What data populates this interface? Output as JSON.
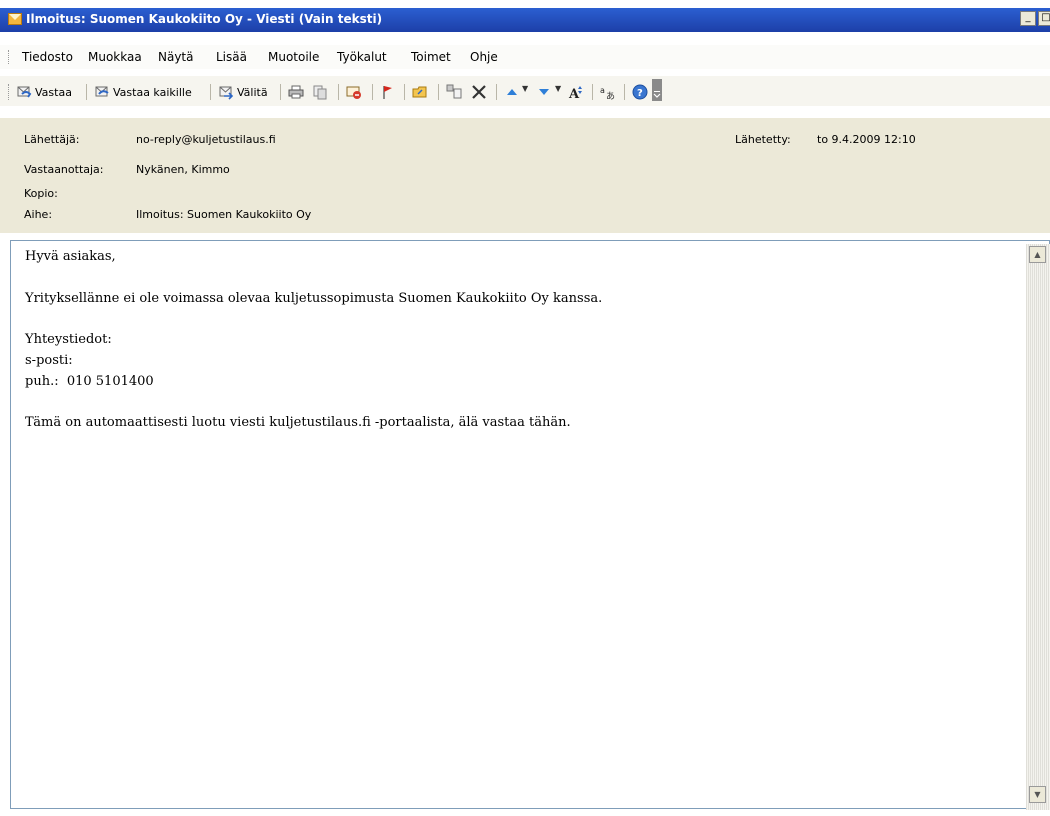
{
  "window": {
    "title": "Ilmoitus: Suomen Kaukokiito Oy - Viesti (Vain teksti)"
  },
  "menu": {
    "items": [
      {
        "label": "Tiedosto"
      },
      {
        "label": "Muokkaa"
      },
      {
        "label": "Näytä"
      },
      {
        "label": "Lisää"
      },
      {
        "label": "Muotoile"
      },
      {
        "label": "Työkalut"
      },
      {
        "label": "Toimet"
      },
      {
        "label": "Ohje"
      }
    ]
  },
  "toolbar": {
    "reply_label": "Vastaa",
    "reply_all_label": "Vastaa kaikille",
    "forward_label": "Välitä"
  },
  "header": {
    "from_label": "Lähettäjä:",
    "from_value": "no-reply@kuljetustilaus.fi",
    "sent_label": "Lähetetty:",
    "sent_value": "to 9.4.2009 12:10",
    "to_label": "Vastaanottaja:",
    "to_value": "Nykänen, Kimmo",
    "cc_label": "Kopio:",
    "cc_value": "",
    "subject_label": "Aihe:",
    "subject_value": "Ilmoitus: Suomen Kaukokiito Oy"
  },
  "body": {
    "lines": [
      "Hyvä asiakas,",
      "",
      "Yrityksellänne ei ole voimassa olevaa kuljetussopimusta Suomen Kaukokiito Oy kanssa.",
      "",
      "Yhteystiedot:",
      "s-posti:",
      "puh.:  010 5101400",
      "",
      "Tämä on automaattisesti luotu viesti kuljetustilaus.fi -portaalista, älä vastaa tähän."
    ]
  }
}
